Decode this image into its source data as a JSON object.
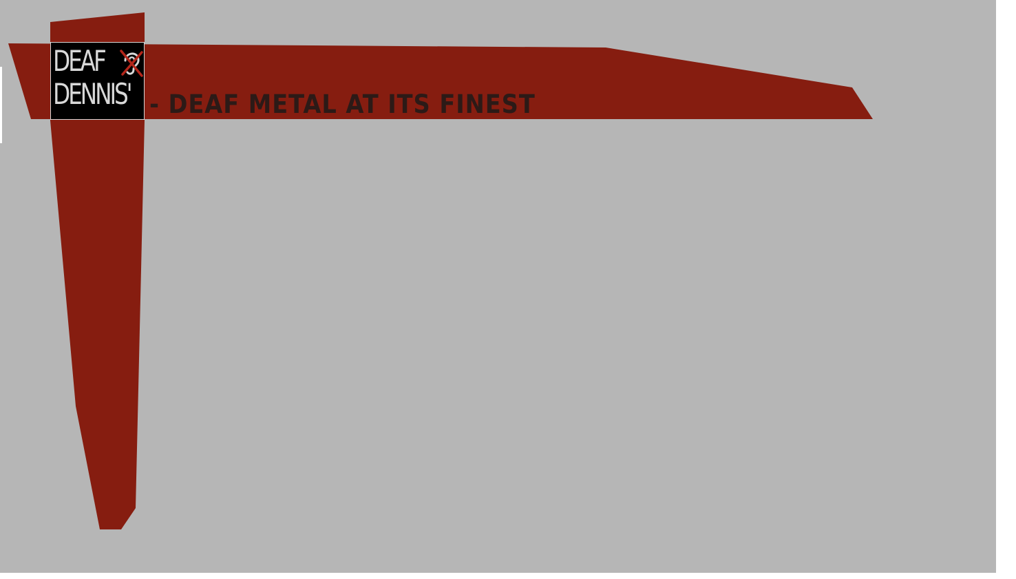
{
  "header": {
    "logo": {
      "line1": "DEAF",
      "line2": "DENNIS'",
      "icon": "crossed-ear-icon"
    },
    "tagline": "- DEAF METAL AT ITS FINEST"
  },
  "colors": {
    "background": "#b6b6b6",
    "accent": "#861d10",
    "logo_background": "#000000",
    "logo_text": "#d8d8d8",
    "tagline_text": "#2c1a17",
    "icon_cross": "#b3261a"
  }
}
